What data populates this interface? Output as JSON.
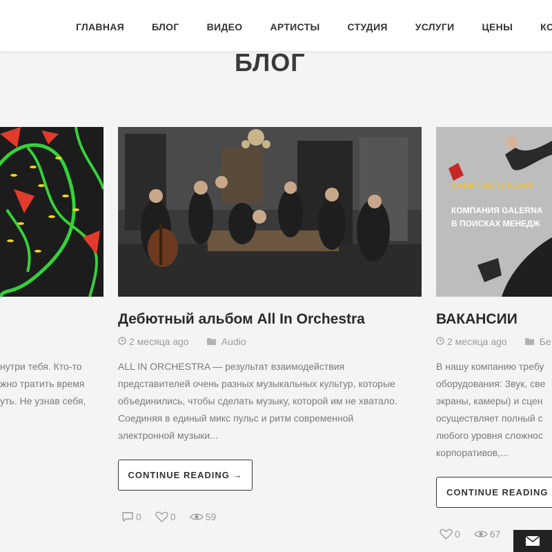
{
  "nav": {
    "items": [
      "ГЛАВНАЯ",
      "БЛОГ",
      "ВИДЕО",
      "АРТИСТЫ",
      "СТУДИЯ",
      "УСЛУГИ",
      "ЦЕНЫ",
      "КО"
    ]
  },
  "page": {
    "title": "БЛОГ"
  },
  "left_card": {
    "excerpt": [
      "нутри тебя. Кто-то",
      "жно тратить время",
      "уть. Не узнав себя,"
    ]
  },
  "center_card": {
    "title": "Дебютный альбом All In Orchestra",
    "date": "2 месяца ago",
    "category": "Audio",
    "excerpt": [
      "ALL IN ORCHESTRA — результат взаимодействия",
      "представителей очень разных музыкальных культур, которые",
      "объединились, чтобы сделать музыку, которой им не хватало.",
      "Соединяя в единый микс пульс и ритм современной",
      "электронной музыки..."
    ],
    "button": "CONTINUE READING →",
    "comments": "0",
    "likes": "0",
    "views": "59"
  },
  "right_card": {
    "image_tag": "САНКТ-ПЕТЕРБУРГ",
    "image_text_1": "КОМПАНИЯ GALERNA",
    "image_text_2": "В ПОИСКАХ МЕНЕДЖ",
    "title": "ВАКАНСИИ",
    "date": "2 месяца ago",
    "category": "Бе",
    "excerpt": [
      "В нашу компанию требу",
      "оборудования: Звук, све",
      "экраны, камеры) и сцен",
      "осуществляет полный с",
      "любого уровня сложнос",
      "корпоративов,..."
    ],
    "button": "CONTINUE READING →",
    "likes": "0",
    "views": "67"
  },
  "colors": {
    "background": "#f4f4f4",
    "tag_yellow": "#f2c230"
  }
}
